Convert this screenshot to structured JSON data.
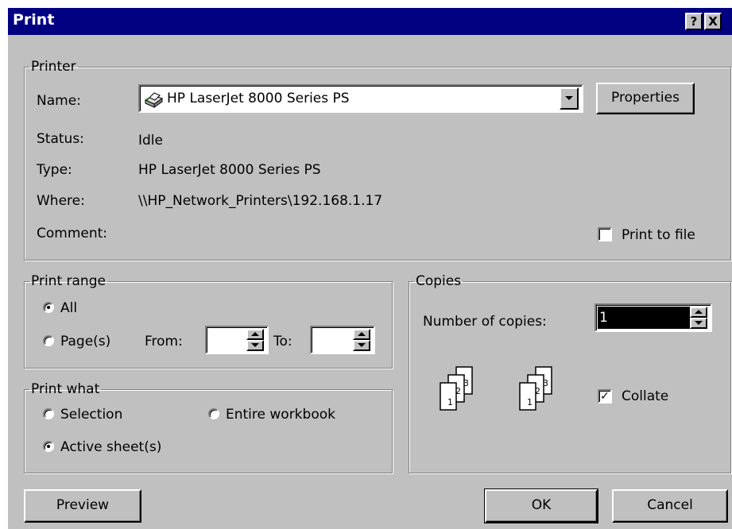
{
  "window": {
    "title": "Print",
    "help_glyph": "?",
    "close_glyph": "X"
  },
  "printer": {
    "group_label": "Printer",
    "name_label": "Name:",
    "name_value": "HP LaserJet 8000 Series PS",
    "properties_label": "Properties",
    "status_label": "Status:",
    "status_value": "Idle",
    "type_label": "Type:",
    "type_value": "HP LaserJet 8000 Series PS",
    "where_label": "Where:",
    "where_value": "\\\\HP_Network_Printers\\192.168.1.17",
    "comment_label": "Comment:",
    "comment_value": "",
    "print_to_file_label": "Print to file",
    "print_to_file_checked": false
  },
  "print_range": {
    "group_label": "Print range",
    "all_label": "All",
    "pages_label": "Page(s)",
    "from_label": "From:",
    "to_label": "To:",
    "from_value": "",
    "to_value": "",
    "selected": "All"
  },
  "print_what": {
    "group_label": "Print what",
    "selection_label": "Selection",
    "entire_workbook_label": "Entire workbook",
    "active_sheets_label": "Active sheet(s)",
    "selected": "Active sheet(s)"
  },
  "copies": {
    "group_label": "Copies",
    "number_label": "Number of copies:",
    "number_value": "1",
    "collate_label": "Collate",
    "collate_checked": true,
    "page_numbers": [
      "1",
      "2",
      "3"
    ]
  },
  "buttons": {
    "preview": "Preview",
    "ok": "OK",
    "cancel": "Cancel"
  },
  "colors": {
    "title_bar": "#000080",
    "face": "#c0c0c0",
    "selection_highlight": "#000080"
  }
}
